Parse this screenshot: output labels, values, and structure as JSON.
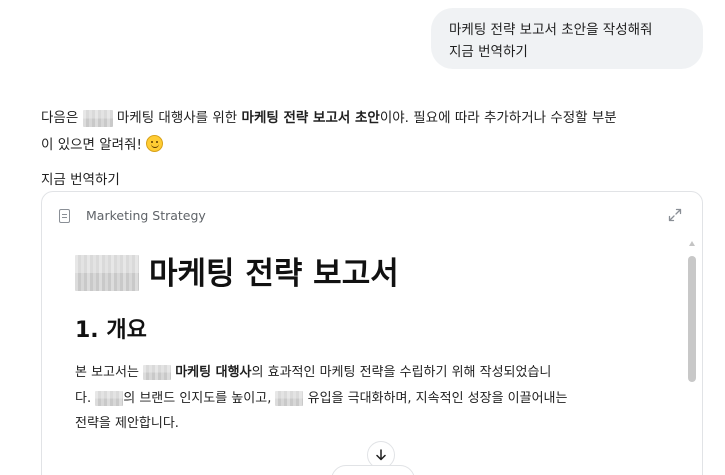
{
  "user_message": {
    "line1": "마케팅 전략 보고서 초안을 작성해줘",
    "line2": "지금 번역하기"
  },
  "assistant_reply": {
    "prefix": "다음은",
    "agency_suffix": "마케팅 대행사를 위한",
    "bold": "마케팅 전략 보고서 초안",
    "rest_line1": "이야. 필요에 따라 추가하거나 수정할 부분",
    "line2": "이 있으면 알려줘!",
    "emoji": "smiling-face-emoji"
  },
  "translate_link": "지금 번역하기",
  "document": {
    "header_title": "Marketing Strategy",
    "h1": "마케팅 전략 보고서",
    "h2": "1. 개요",
    "p1_prefix": "본 보고서는",
    "p1_bold": "마케팅 대행사",
    "p1_rest": "의 효과적인 마케팅 전략을 수립하기 위해 작성되었습니",
    "p2_prefix": "다.",
    "p2_mid": "의 브랜드 인지도를 높이고,",
    "p2_rest": "유입을 극대화하며, 지속적인 성장을 이끌어내는",
    "p3": "전략을 제안합니다."
  },
  "icons": {
    "doc": "document-icon",
    "expand": "expand-icon",
    "scroll_down": "arrow-down-icon"
  },
  "colors": {
    "bubble_bg": "#f0f2f4",
    "border": "#e1e3e6",
    "muted_text": "#5f6368"
  }
}
